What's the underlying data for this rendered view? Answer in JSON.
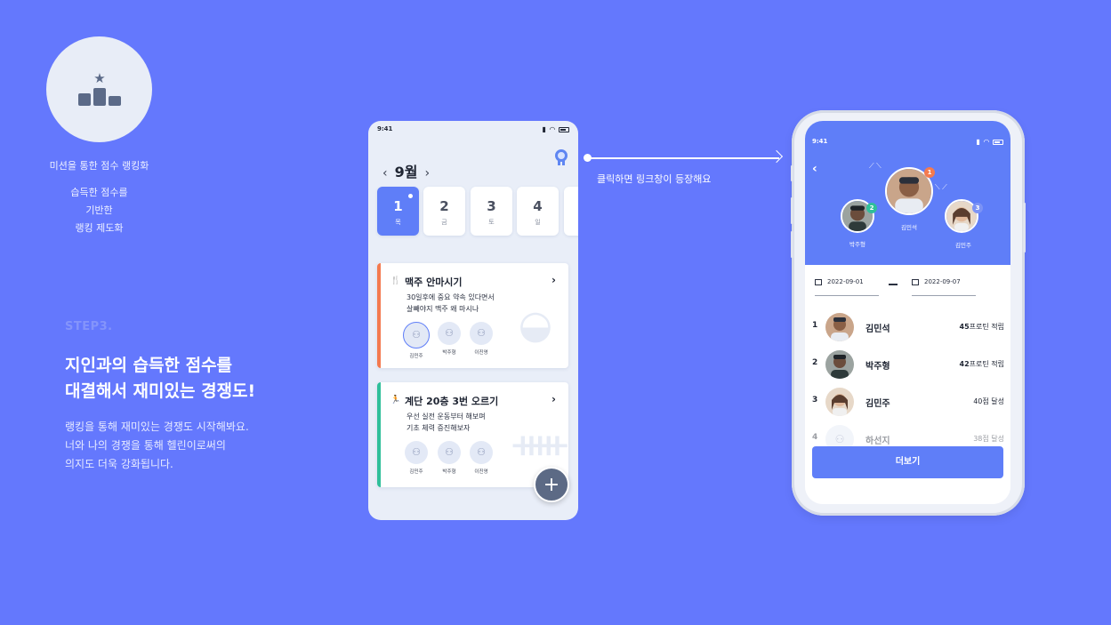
{
  "intro": {
    "feature_title": "미션을 통한 점수 랭킹화",
    "feature_desc_lines": [
      "습득한 점수를",
      "기반한",
      "랭킹 제도화"
    ],
    "step": "STEP3.",
    "headline_lines": [
      "지인과의 습득한 점수를",
      "대결해서 재미있는 경쟁도!"
    ],
    "body_lines": [
      "랭킹을 통해 재미있는 경쟁도 시작해봐요.",
      "너와 나의 경쟁을 통해 헬린이로써의",
      "의지도 더욱 강화됩니다."
    ]
  },
  "arrow_caption": "클릭하면 링크창이 등장해요",
  "phone1": {
    "time": "9:41",
    "month": "9월",
    "days": [
      {
        "num": "1",
        "dow": "목"
      },
      {
        "num": "2",
        "dow": "금"
      },
      {
        "num": "3",
        "dow": "토"
      },
      {
        "num": "4",
        "dow": "일"
      }
    ],
    "missions": [
      {
        "title": "맥주 안마시기",
        "desc1": "30일후에 중요 약속 있다면서",
        "desc2": "살빼야지 맥주 왜 마시나",
        "members": [
          "김민주",
          "박주형",
          "이진영"
        ]
      },
      {
        "title": "계단 20층 3번 오르기",
        "desc1": "우선 실전 운동부터 해보며",
        "desc2": "기초 체력 증진해보자",
        "members": [
          "김민주",
          "박주형",
          "이진영"
        ]
      }
    ],
    "fab_label": "+"
  },
  "phone2": {
    "time": "9:41",
    "podium": [
      {
        "rank": "1",
        "name": "김민석"
      },
      {
        "rank": "2",
        "name": "박주형"
      },
      {
        "rank": "3",
        "name": "김민주"
      }
    ],
    "date_from": "2022-09-01",
    "date_to": "2022-09-07",
    "ranking": [
      {
        "rank": "1",
        "name": "김민석",
        "score_num": "45",
        "score_unit": "프로틴 적립"
      },
      {
        "rank": "2",
        "name": "박주형",
        "score_num": "42",
        "score_unit": "프로틴 적립"
      },
      {
        "rank": "3",
        "name": "김민주",
        "score_num": "",
        "score_unit": "40점 달성"
      },
      {
        "rank": "4",
        "name": "하선지",
        "score_num": "",
        "score_unit": "38점 달성"
      }
    ],
    "more_label": "더보기"
  },
  "colors": {
    "background": "#6478fd",
    "accent": "#5f7ef8",
    "mission1_accent": "#f47a4f",
    "mission2_accent": "#2fbf9a",
    "rank1_badge": "#f47a4f",
    "rank2_badge": "#2fbf9a",
    "rank3_badge": "#7c93f5"
  }
}
